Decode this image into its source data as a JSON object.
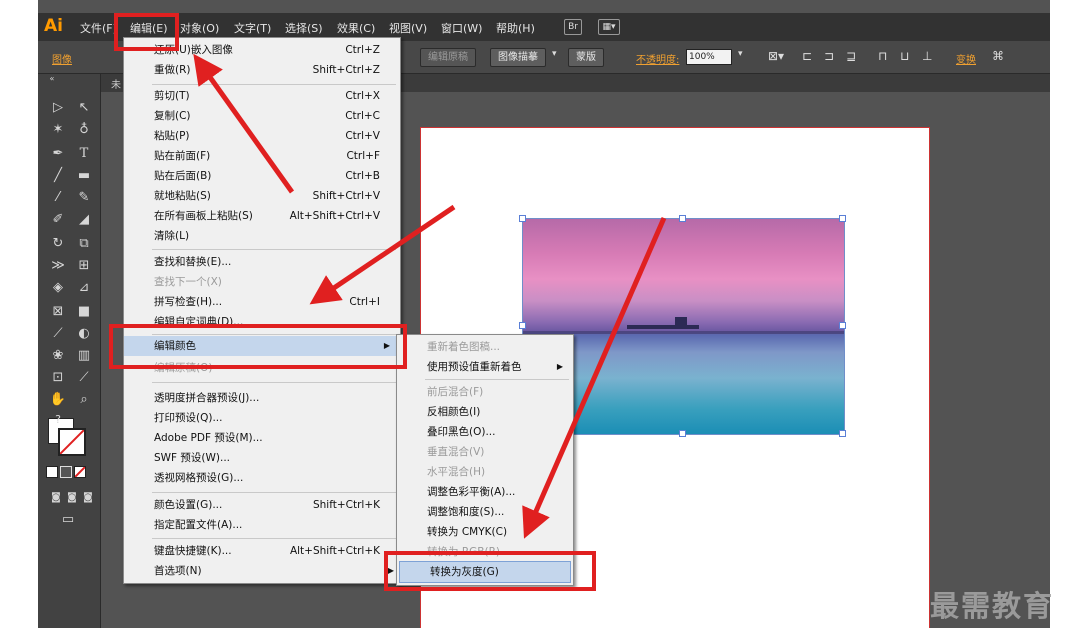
{
  "menubar": {
    "logo": "Ai",
    "items": [
      "文件(F)",
      "编辑(E)",
      "对象(O)",
      "文字(T)",
      "选择(S)",
      "效果(C)",
      "视图(V)",
      "窗口(W)",
      "帮助(H)"
    ],
    "br_button": "Br"
  },
  "controlbar": {
    "label": "图像",
    "edit_original": "编辑原稿",
    "image_trace": "图像描摹",
    "mask": "蒙版",
    "opacity_label": "不透明度:",
    "opacity_value": "100%",
    "transform_link": "变换"
  },
  "document_tab": {
    "label": "未"
  },
  "edit_menu": {
    "items": [
      {
        "label": "还原(U)嵌入图像",
        "shortcut": "Ctrl+Z"
      },
      {
        "label": "重做(R)",
        "shortcut": "Shift+Ctrl+Z"
      },
      {
        "label": "剪切(T)",
        "shortcut": "Ctrl+X"
      },
      {
        "label": "复制(C)",
        "shortcut": "Ctrl+C"
      },
      {
        "label": "粘贴(P)",
        "shortcut": "Ctrl+V"
      },
      {
        "label": "贴在前面(F)",
        "shortcut": "Ctrl+F"
      },
      {
        "label": "贴在后面(B)",
        "shortcut": "Ctrl+B"
      },
      {
        "label": "就地粘贴(S)",
        "shortcut": "Shift+Ctrl+V"
      },
      {
        "label": "在所有画板上粘贴(S)",
        "shortcut": "Alt+Shift+Ctrl+V"
      },
      {
        "label": "清除(L)",
        "shortcut": ""
      },
      {
        "label": "查找和替换(E)...",
        "shortcut": ""
      },
      {
        "label": "查找下一个(X)",
        "shortcut": ""
      },
      {
        "label": "拼写检查(H)...",
        "shortcut": "Ctrl+I"
      },
      {
        "label": "编辑自定词典(D)...",
        "shortcut": ""
      },
      {
        "label": "编辑颜色",
        "shortcut": ""
      },
      {
        "label": "编辑原稿(O)",
        "shortcut": ""
      },
      {
        "label": "透明度拼合器预设(J)...",
        "shortcut": ""
      },
      {
        "label": "打印预设(Q)...",
        "shortcut": ""
      },
      {
        "label": "Adobe PDF 预设(M)...",
        "shortcut": ""
      },
      {
        "label": "SWF 预设(W)...",
        "shortcut": ""
      },
      {
        "label": "透视网格预设(G)...",
        "shortcut": ""
      },
      {
        "label": "颜色设置(G)...",
        "shortcut": "Shift+Ctrl+K"
      },
      {
        "label": "指定配置文件(A)...",
        "shortcut": ""
      },
      {
        "label": "键盘快捷键(K)...",
        "shortcut": "Alt+Shift+Ctrl+K"
      },
      {
        "label": "首选项(N)",
        "shortcut": ""
      }
    ]
  },
  "color_submenu": {
    "items": [
      {
        "label": "重新着色图稿..."
      },
      {
        "label": "使用预设值重新着色"
      },
      {
        "label": "前后混合(F)"
      },
      {
        "label": "反相颜色(I)"
      },
      {
        "label": "叠印黑色(O)..."
      },
      {
        "label": "垂直混合(V)"
      },
      {
        "label": "水平混合(H)"
      },
      {
        "label": "调整色彩平衡(A)..."
      },
      {
        "label": "调整饱和度(S)..."
      },
      {
        "label": "转换为 CMYK(C)"
      },
      {
        "label": "转换为 RGB(R)"
      },
      {
        "label": "转换为灰度(G)"
      }
    ]
  },
  "toolbox": {
    "tools": [
      "selection-tool",
      "direct-selection-tool",
      "magic-wand-tool",
      "lasso-tool",
      "pen-tool",
      "type-tool",
      "line-tool",
      "rectangle-tool",
      "paintbrush-tool",
      "pencil-tool",
      "blob-brush-tool",
      "eraser-tool",
      "rotate-tool",
      "scale-tool",
      "width-tool",
      "free-transform-tool",
      "shape-builder-tool",
      "perspective-grid-tool",
      "mesh-tool",
      "gradient-tool",
      "eyedropper-tool",
      "blend-tool",
      "symbol-sprayer-tool",
      "column-graph-tool",
      "artboard-tool",
      "slice-tool",
      "hand-tool",
      "zoom-tool"
    ],
    "swap_glyph": "?"
  },
  "watermark": "最需教育",
  "colors": {
    "highlight": "#c4d6ec",
    "annotation_red": "#e02020",
    "logo": "#ff9a00"
  }
}
